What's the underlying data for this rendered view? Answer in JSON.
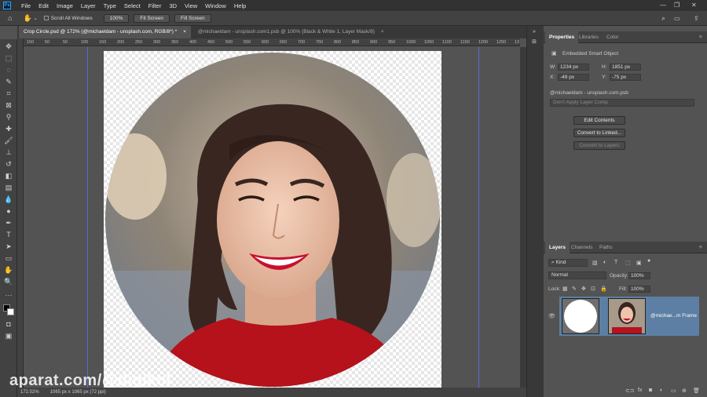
{
  "menubar": {
    "items": [
      "File",
      "Edit",
      "Image",
      "Layer",
      "Type",
      "Select",
      "Filter",
      "3D",
      "View",
      "Window",
      "Help"
    ]
  },
  "options_bar": {
    "scroll_all_windows": "Scroll All Windows",
    "zoom_value": "100%",
    "fit_screen": "Fit Screen",
    "fill_screen": "Fill Screen"
  },
  "document_tabs": [
    {
      "label": "Crop Circle.psd @ 172% (@michaeldam - unsplash.com, RGB/8*) *",
      "close": "×",
      "active": true
    },
    {
      "label": "@michaeldam - unsplash.com1.psb @ 100% (Black & White 1, Layer Mask/8)",
      "close": "×",
      "active": false
    }
  ],
  "ruler_ticks": [
    "150",
    "50",
    "50",
    "100",
    "150",
    "200",
    "250",
    "300",
    "350",
    "400",
    "450",
    "500",
    "550",
    "600",
    "650",
    "700",
    "750",
    "800",
    "850",
    "900",
    "950",
    "1000",
    "1050",
    "1100",
    "1150",
    "1200",
    "1250",
    "13"
  ],
  "status_bar": {
    "zoom": "172.02%",
    "doc_size": "1065 px x 1065 px (72 ppi)"
  },
  "watermark": "aparat.com/@digikol",
  "properties_panel": {
    "tabs": [
      "Properties",
      "Libraries",
      "Color"
    ],
    "object_type": "Embedded Smart Object",
    "w_label": "W:",
    "w_value": "1234 px",
    "h_label": "H:",
    "h_value": "1851 px",
    "x_label": "X:",
    "x_value": "-49 px",
    "y_label": "Y:",
    "y_value": "-75 px",
    "filename": "@michaeldam - unsplash.com.psb",
    "layer_comp": "Don't Apply Layer Comp",
    "edit_contents": "Edit Contents",
    "convert_linked": "Convert to Linked...",
    "convert_layers": "Convert to Layers"
  },
  "layers_panel": {
    "tabs": [
      "Layers",
      "Channels",
      "Paths"
    ],
    "filter_kind": "Kind",
    "blend_mode": "Normal",
    "opacity_label": "Opacity:",
    "opacity_value": "100%",
    "lock_label": "Lock:",
    "fill_label": "Fill:",
    "fill_value": "100%",
    "layer_name": "@michae...m Frame"
  },
  "colors": {
    "accent_selected_layer": "#5d7fa3",
    "guide": "#5a6cd6",
    "lipstick": "#c8102e",
    "sweater": "#b5121b"
  }
}
